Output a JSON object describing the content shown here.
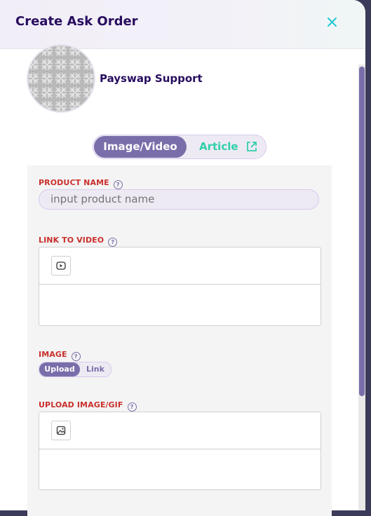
{
  "modal": {
    "title": "Create Ask Order",
    "close_icon": "close-icon"
  },
  "profile": {
    "name": "Payswap Support"
  },
  "mode_toggle": {
    "active": "Image/Video",
    "other": "Article",
    "other_icon": "external-link-icon"
  },
  "fields": {
    "product_name": {
      "label": "PRODUCT NAME",
      "placeholder": "input product name"
    },
    "link_to_video": {
      "label": "LINK TO VIDEO",
      "tool_icon": "youtube-icon"
    },
    "image": {
      "label": "IMAGE",
      "toggle_active": "Upload",
      "toggle_other": "Link"
    },
    "upload_image": {
      "label": "UPLOAD IMAGE/GIF",
      "tool_icon": "image-icon"
    }
  },
  "colors": {
    "title": "#280d5f",
    "accent": "#7a6eaa",
    "label": "#c9302c",
    "link": "#31d0aa",
    "close": "#1fc7d4"
  }
}
